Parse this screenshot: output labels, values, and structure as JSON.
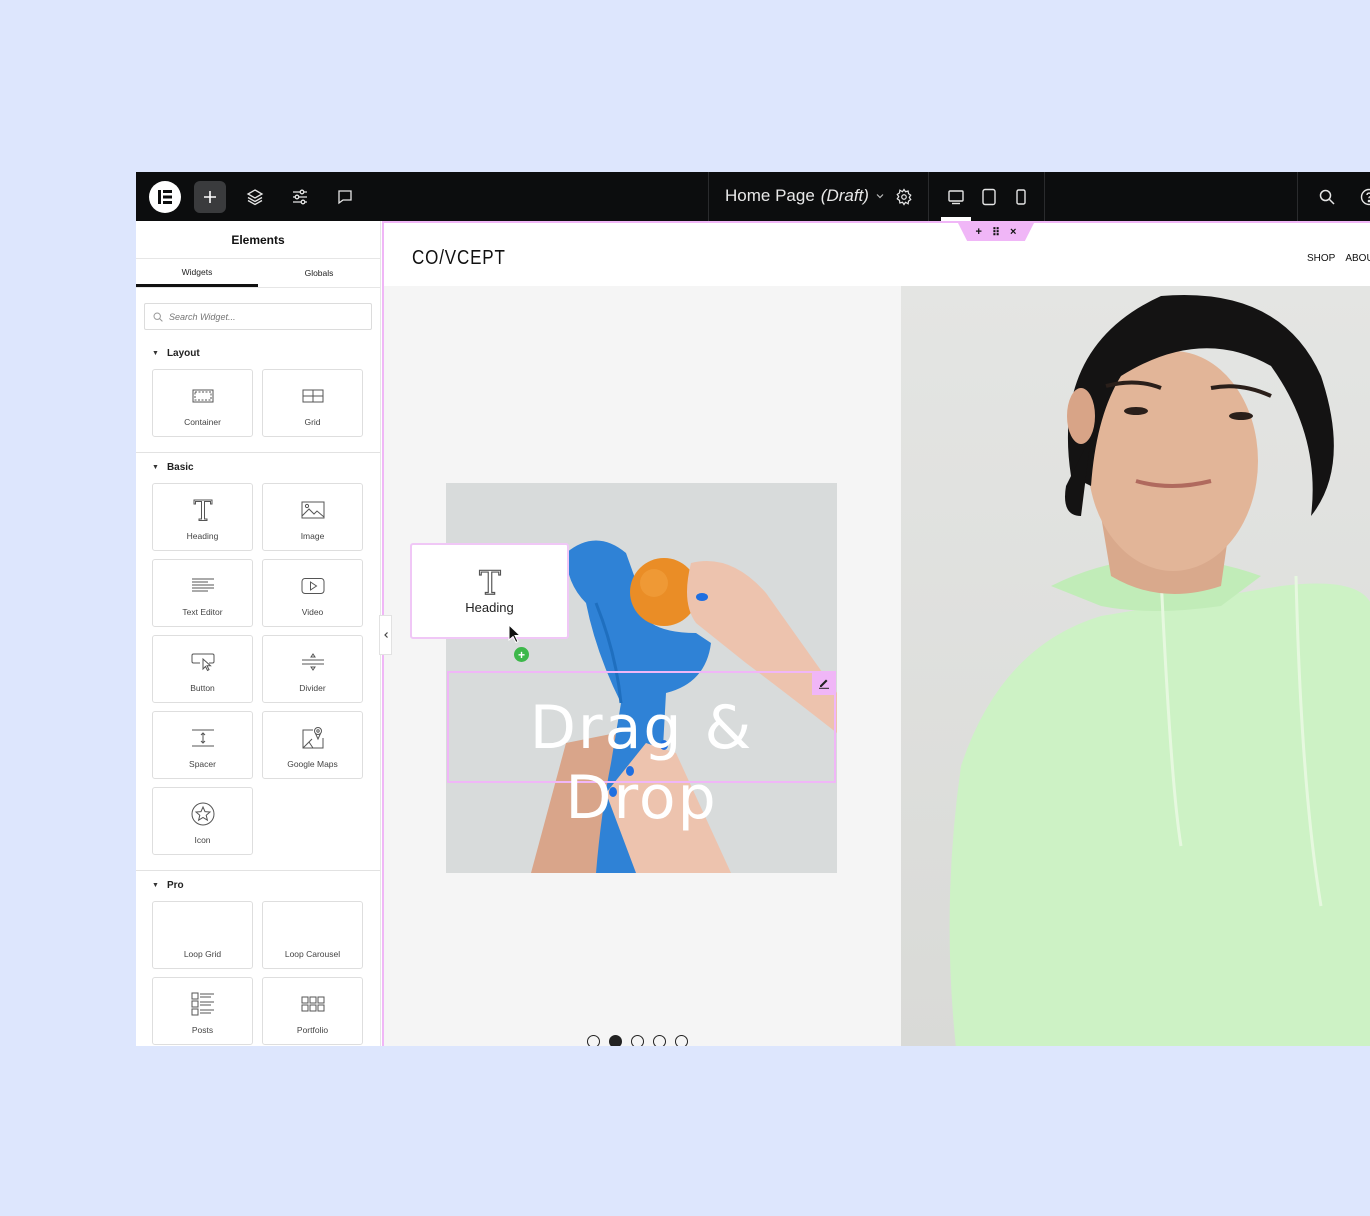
{
  "topbar": {
    "page_title": "Home Page",
    "page_status": "(Draft)",
    "icons": [
      "elementor-logo-icon",
      "plus-icon",
      "layers-icon",
      "sliders-icon",
      "comment-icon",
      "chevron-down-icon",
      "gear-icon",
      "desktop-icon",
      "tablet-icon",
      "mobile-icon",
      "search-icon",
      "help-icon"
    ],
    "active_device": "desktop"
  },
  "sidebar": {
    "title": "Elements",
    "tabs": [
      {
        "label": "Widgets",
        "active": true
      },
      {
        "label": "Globals",
        "active": false
      }
    ],
    "search_placeholder": "Search Widget...",
    "sections": [
      {
        "title": "Layout",
        "widgets": [
          {
            "label": "Container",
            "icon": "container-icon"
          },
          {
            "label": "Grid",
            "icon": "grid-icon"
          }
        ]
      },
      {
        "title": "Basic",
        "widgets": [
          {
            "label": "Heading",
            "icon": "heading-icon"
          },
          {
            "label": "Image",
            "icon": "image-icon"
          },
          {
            "label": "Text Editor",
            "icon": "text-editor-icon"
          },
          {
            "label": "Video",
            "icon": "video-icon"
          },
          {
            "label": "Button",
            "icon": "button-icon"
          },
          {
            "label": "Divider",
            "icon": "divider-icon"
          },
          {
            "label": "Spacer",
            "icon": "spacer-icon"
          },
          {
            "label": "Google Maps",
            "icon": "map-icon"
          },
          {
            "label": "Icon",
            "icon": "star-icon"
          }
        ]
      },
      {
        "title": "Pro",
        "widgets": [
          {
            "label": "Loop Grid",
            "icon": ""
          },
          {
            "label": "Loop Carousel",
            "icon": ""
          },
          {
            "label": "Posts",
            "icon": "posts-icon"
          },
          {
            "label": "Portfolio",
            "icon": "portfolio-icon"
          }
        ]
      }
    ]
  },
  "canvas": {
    "site_logo": "CO/VCEPT",
    "nav": [
      "SHOP",
      "ABOU"
    ],
    "section_handle": {
      "add": "+",
      "drag": "⠿",
      "close": "×"
    },
    "heading_text": "Drag & Drop",
    "drag_card_label": "Heading",
    "slider_dots": {
      "count": 5,
      "active_index": 1
    }
  },
  "colors": {
    "accent": "#f0b6f7",
    "topbar": "#0c0d0e",
    "background": "#dde6fd",
    "add_badge": "#3db84a"
  }
}
